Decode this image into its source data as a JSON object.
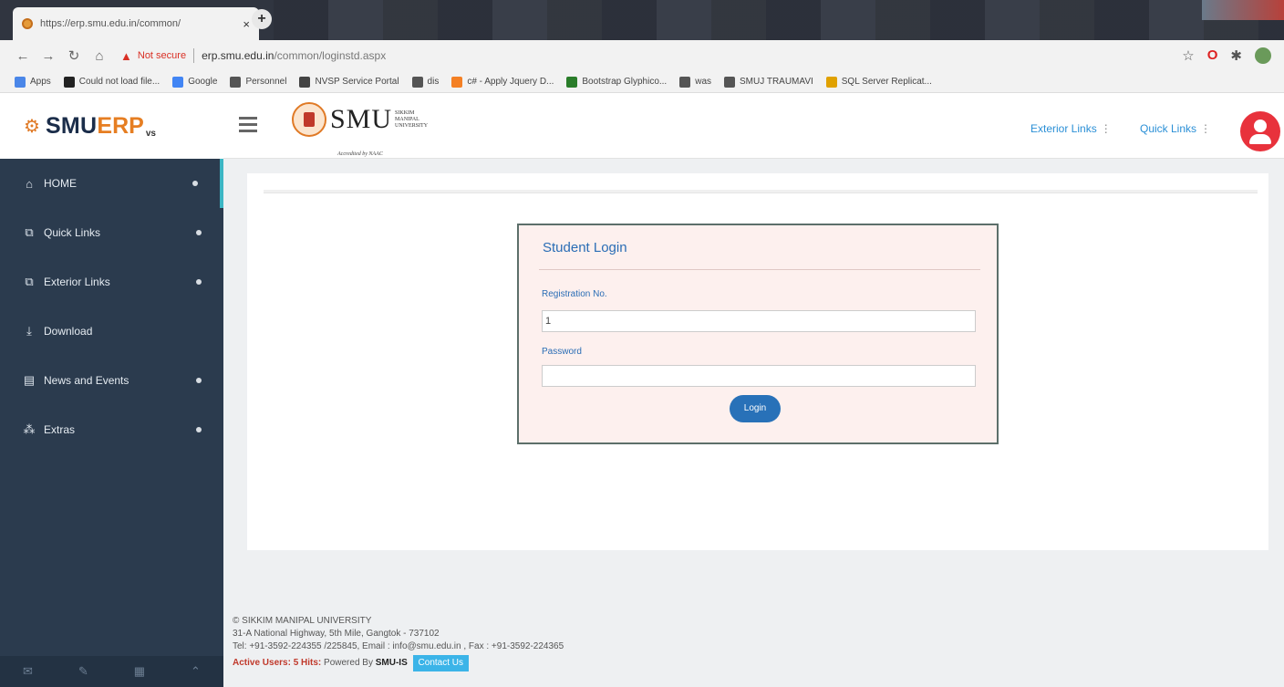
{
  "browser": {
    "tab_title": "https://erp.smu.edu.in/common/",
    "tab_close": "×",
    "new_tab": "+",
    "not_secure": "Not secure",
    "url_host": "erp.smu.edu.in",
    "url_path": "/common/loginstd.aspx",
    "bookmarks": [
      {
        "label": "Apps",
        "icon": "apps-icon",
        "color": "#4a86e8"
      },
      {
        "label": "Could not load file...",
        "icon": "ai-icon",
        "color": "#222222"
      },
      {
        "label": "Google",
        "icon": "google-icon",
        "color": "#4285f4"
      },
      {
        "label": "Personnel",
        "icon": "globe-icon",
        "color": "#555555"
      },
      {
        "label": "NVSP Service Portal",
        "icon": "diamond-icon",
        "color": "#444444"
      },
      {
        "label": "dis",
        "icon": "globe-icon",
        "color": "#555555"
      },
      {
        "label": "c# - Apply Jquery D...",
        "icon": "stackoverflow-icon",
        "color": "#f48024"
      },
      {
        "label": "Bootstrap Glyphico...",
        "icon": "w-icon",
        "color": "#2a7d2a"
      },
      {
        "label": "was",
        "icon": "globe-icon",
        "color": "#555555"
      },
      {
        "label": "SMUJ TRAUMAVI",
        "icon": "globe-icon",
        "color": "#555555"
      },
      {
        "label": "SQL Server Replicat...",
        "icon": "sql-icon",
        "color": "#e0a100"
      }
    ]
  },
  "header": {
    "brand_smu": "SMU",
    "brand_erp": "ERP",
    "brand_v": "vs",
    "logo_text": "SMU",
    "logo_side_1": "SIKKIM",
    "logo_side_2": "MANIPAL",
    "logo_side_3": "UNIVERSITY",
    "logo_accreditation": "Accredited by NAAC",
    "exterior_links": "Exterior Links",
    "quick_links": "Quick Links",
    "dots": "⋮"
  },
  "sidebar": {
    "items": [
      {
        "label": "HOME",
        "icon": "home-icon",
        "glyph": "⌂",
        "has_dot": true,
        "active": true
      },
      {
        "label": "Quick Links",
        "icon": "external-link-icon",
        "glyph": "⧉",
        "has_dot": true
      },
      {
        "label": "Exterior Links",
        "icon": "external-link-icon",
        "glyph": "⧉",
        "has_dot": true
      },
      {
        "label": "Download",
        "icon": "download-icon",
        "glyph": "⤓",
        "has_dot": false
      },
      {
        "label": "News and Events",
        "icon": "newspaper-icon",
        "glyph": "▤",
        "has_dot": true
      },
      {
        "label": "Extras",
        "icon": "sitemap-icon",
        "glyph": "⁂",
        "has_dot": true
      }
    ]
  },
  "login": {
    "title": "Student Login",
    "reg_label": "Registration No.",
    "reg_value": "1",
    "password_label": "Password",
    "password_value": "",
    "button": "Login"
  },
  "footer": {
    "line1": "© SIKKIM MANIPAL UNIVERSITY",
    "line2": "31-A National Highway, 5th Mile, Gangtok - 737102",
    "line3": "Tel: +91-3592-224355 /225845, Email : info@smu.edu.in , Fax : +91-3592-224365",
    "active_users": "Active Users: 5 Hits:",
    "powered_by": "Powered By",
    "smu_is": "SMU-IS",
    "contact": "Contact Us"
  }
}
